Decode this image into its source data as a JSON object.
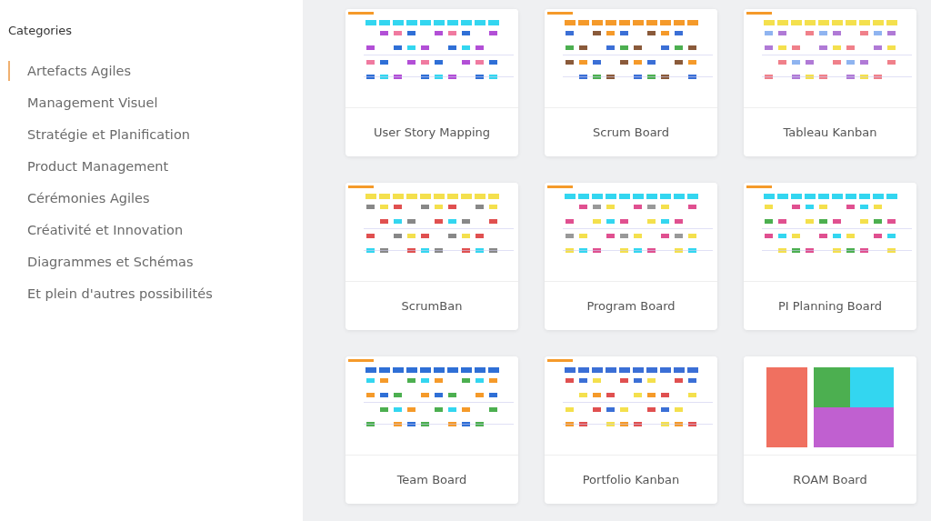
{
  "sidebar": {
    "heading": "Categories",
    "items": [
      {
        "label": "Artefacts Agiles",
        "selected": true
      },
      {
        "label": "Management Visuel",
        "selected": false
      },
      {
        "label": "Stratégie et Planification",
        "selected": false
      },
      {
        "label": "Product Management",
        "selected": false
      },
      {
        "label": "Cérémonies Agiles",
        "selected": false
      },
      {
        "label": "Créativité et Innovation",
        "selected": false
      },
      {
        "label": "Diagrammes et Schémas",
        "selected": false
      },
      {
        "label": "Et plein d'autres possibilités",
        "selected": false
      }
    ]
  },
  "templates": [
    {
      "title": "User Story Mapping"
    },
    {
      "title": "Scrum Board"
    },
    {
      "title": "Tableau Kanban"
    },
    {
      "title": "ScrumBan"
    },
    {
      "title": "Program Board"
    },
    {
      "title": "PI Planning Board"
    },
    {
      "title": "Team Board"
    },
    {
      "title": "Portfolio Kanban"
    },
    {
      "title": "ROAM Board"
    }
  ]
}
